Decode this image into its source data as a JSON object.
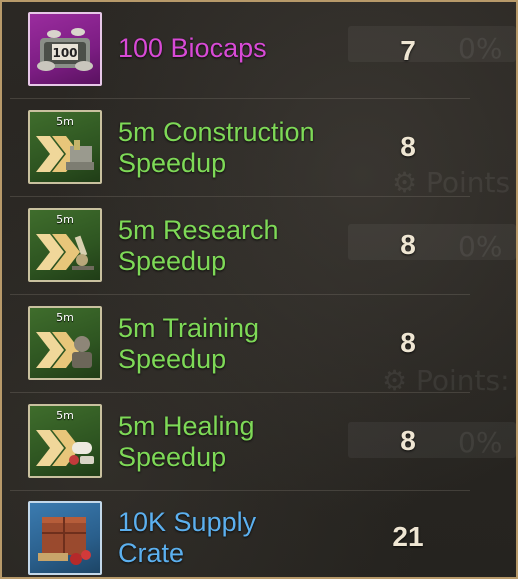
{
  "colors": {
    "common_green": "#7ed957",
    "epic_purple": "#d84ad6",
    "rare_blue": "#5cb0ef",
    "quantity": "#efe6d3",
    "frame": "#b89a6a"
  },
  "items": [
    {
      "name": "100 Biocaps",
      "name_line2": "",
      "quantity": "7",
      "rarity": "purple",
      "icon": "biocaps-icon",
      "icon_tag": "100"
    },
    {
      "name": "5m Construction",
      "name_line2": "Speedup",
      "quantity": "8",
      "rarity": "green",
      "icon": "construction-speedup-icon",
      "icon_tag": "5m"
    },
    {
      "name": "5m Research",
      "name_line2": "Speedup",
      "quantity": "8",
      "rarity": "green",
      "icon": "research-speedup-icon",
      "icon_tag": "5m"
    },
    {
      "name": "5m Training",
      "name_line2": "Speedup",
      "quantity": "8",
      "rarity": "green",
      "icon": "training-speedup-icon",
      "icon_tag": "5m"
    },
    {
      "name": "5m Healing",
      "name_line2": "Speedup",
      "quantity": "8",
      "rarity": "green",
      "icon": "healing-speedup-icon",
      "icon_tag": "5m"
    },
    {
      "name": "10K Supply",
      "name_line2": "Crate",
      "quantity": "21",
      "rarity": "blue",
      "icon": "supply-crate-icon",
      "icon_tag": ""
    }
  ]
}
